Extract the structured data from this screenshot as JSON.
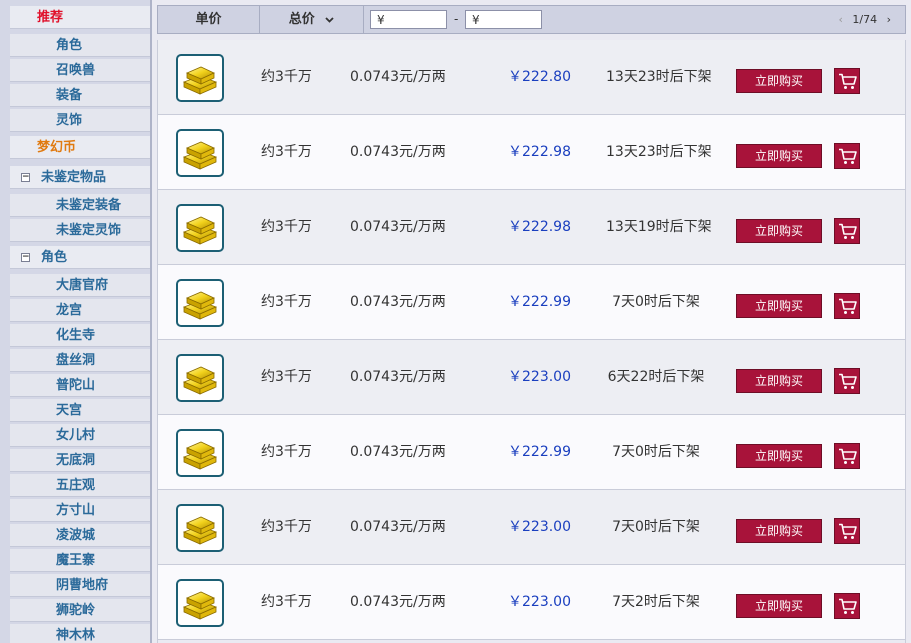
{
  "sidebar": {
    "recommend": "推荐",
    "recommend_items": [
      "角色",
      "召唤兽",
      "装备",
      "灵饰"
    ],
    "currency": "梦幻币",
    "unidentified": {
      "label": "未鉴定物品",
      "toggle": "−",
      "items": [
        "未鉴定装备",
        "未鉴定灵饰"
      ]
    },
    "roles": {
      "label": "角色",
      "toggle": "−",
      "items": [
        "大唐官府",
        "龙宫",
        "化生寺",
        "盘丝洞",
        "普陀山",
        "天宫",
        "女儿村",
        "无底洞",
        "五庄观",
        "方寸山",
        "凌波城",
        "魔王寨",
        "阴曹地府",
        "狮驼岭",
        "神木林"
      ]
    }
  },
  "header": {
    "unit_price": "单价",
    "total_price": "总价",
    "sort_icon": "chevron-down-icon",
    "min_price_placeholder": "¥",
    "max_price_placeholder": "¥",
    "range_dash": "-",
    "pager": {
      "prev": "‹",
      "text": "1/74",
      "next": "›"
    }
  },
  "listings": [
    {
      "amount": "约3千万",
      "unit_price": "0.0743元/万两",
      "price": "￥222.80",
      "time_left": "13天23时后下架"
    },
    {
      "amount": "约3千万",
      "unit_price": "0.0743元/万两",
      "price": "￥222.98",
      "time_left": "13天23时后下架"
    },
    {
      "amount": "约3千万",
      "unit_price": "0.0743元/万两",
      "price": "￥222.98",
      "time_left": "13天19时后下架"
    },
    {
      "amount": "约3千万",
      "unit_price": "0.0743元/万两",
      "price": "￥222.99",
      "time_left": "7天0时后下架"
    },
    {
      "amount": "约3千万",
      "unit_price": "0.0743元/万两",
      "price": "￥223.00",
      "time_left": "6天22时后下架"
    },
    {
      "amount": "约3千万",
      "unit_price": "0.0743元/万两",
      "price": "￥222.99",
      "time_left": "7天0时后下架"
    },
    {
      "amount": "约3千万",
      "unit_price": "0.0743元/万两",
      "price": "￥223.00",
      "time_left": "7天0时后下架"
    },
    {
      "amount": "约3千万",
      "unit_price": "0.0743元/万两",
      "price": "￥223.00",
      "time_left": "7天2时后下架"
    }
  ],
  "buy_label": "立即购买",
  "icons": {
    "thumb": "gold-bars-icon",
    "cart": "cart-icon"
  },
  "colors": {
    "accent_button": "#a8133a",
    "price_text": "#1a3fbf",
    "recommend_text": "#e0102a",
    "currency_text": "#e07a10",
    "nav_text": "#2b6a9a"
  }
}
